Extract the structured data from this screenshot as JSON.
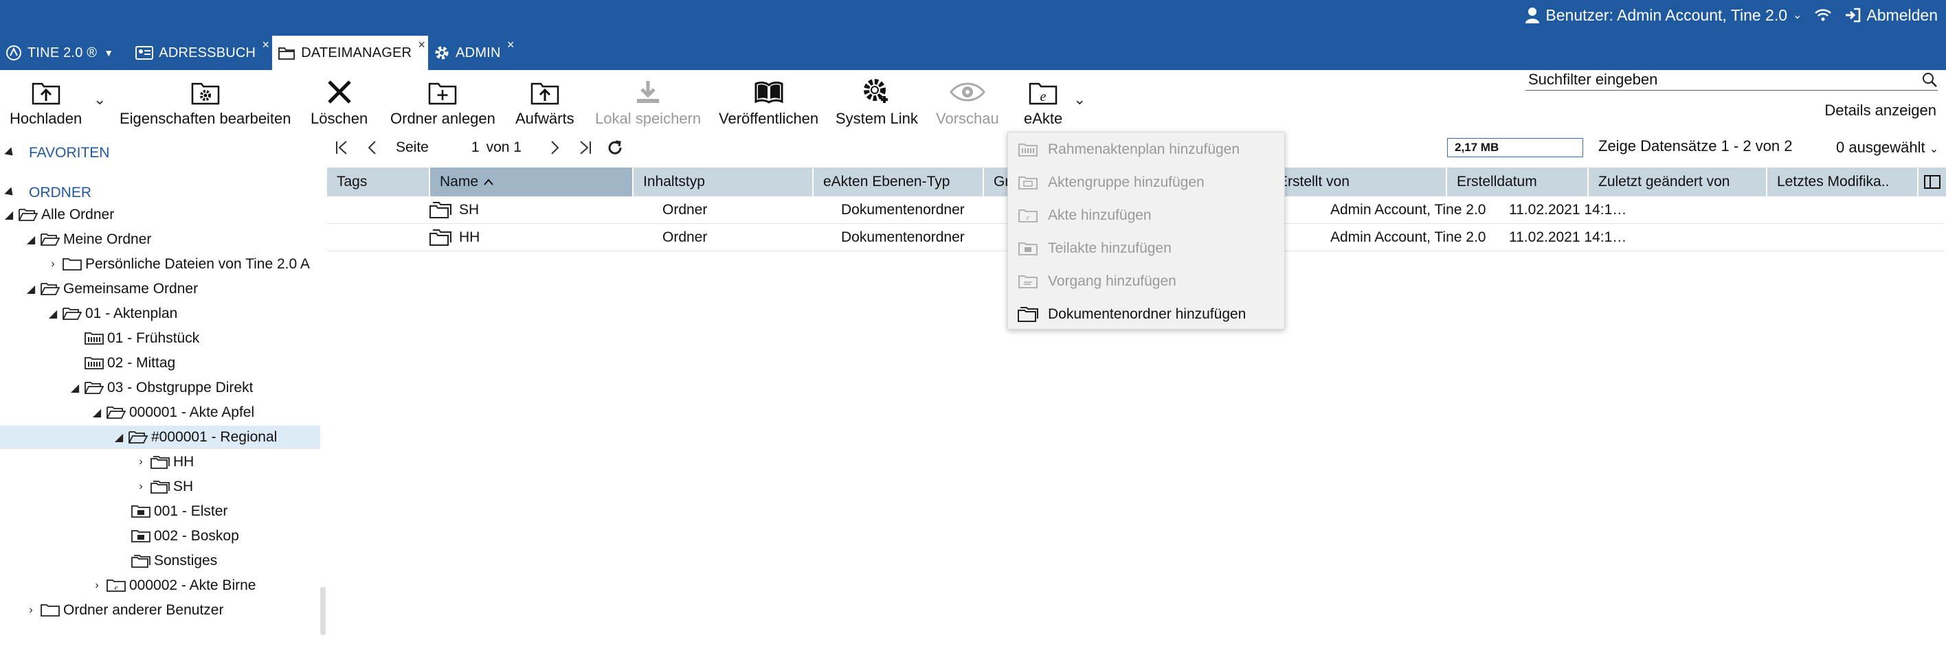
{
  "header": {
    "user_label": "Benutzer: Admin Account, Tine 2.0",
    "logout_label": "Abmelden"
  },
  "tabs": [
    {
      "label": "TINE 2.0 ®",
      "icon": "tine-logo-icon"
    },
    {
      "label": "ADRESSBUCH",
      "icon": "addressbook-icon"
    },
    {
      "label": "DATEIMANAGER",
      "icon": "filemanager-icon"
    },
    {
      "label": "ADMIN",
      "icon": "gear-icon"
    }
  ],
  "toolbar": {
    "upload": "Hochladen",
    "edit_properties": "Eigenschaften bearbeiten",
    "delete": "Löschen",
    "create_folder": "Ordner anlegen",
    "up": "Aufwärts",
    "save_locally": "Lokal speichern",
    "publish": "Veröffentlichen",
    "system_link": "System Link",
    "preview": "Vorschau",
    "eakte": "eAkte"
  },
  "search": {
    "placeholder": "Suchfilter eingeben"
  },
  "details_link": "Details anzeigen",
  "tree": {
    "favorites": "FAVORITEN",
    "folders": "ORDNER",
    "nodes": [
      {
        "label": "Alle Ordner"
      },
      {
        "label": "Meine Ordner"
      },
      {
        "label": "Persönliche Dateien von Tine 2.0 A"
      },
      {
        "label": "Gemeinsame Ordner"
      },
      {
        "label": "01 - Aktenplan"
      },
      {
        "label": "01 - Frühstück"
      },
      {
        "label": "02 - Mittag"
      },
      {
        "label": "03 - Obstgruppe Direkt"
      },
      {
        "label": "000001 - Akte Apfel"
      },
      {
        "label": "#000001 - Regional"
      },
      {
        "label": "HH"
      },
      {
        "label": "SH"
      },
      {
        "label": "001 - Elster"
      },
      {
        "label": "002 - Boskop"
      },
      {
        "label": "Sonstiges"
      },
      {
        "label": "000002 - Akte Birne"
      },
      {
        "label": "Ordner anderer Benutzer"
      }
    ]
  },
  "pager": {
    "page_label": "Seite",
    "page_value": "1",
    "of_label": "von 1",
    "size": "2,17 MB",
    "records": "Zeige Datensätze 1 - 2 von 2",
    "selected": "0 ausgewählt"
  },
  "columns": [
    "Tags",
    "Name",
    "Inhaltstyp",
    "eAkten Ebenen-Typ",
    "Gr",
    "Erstellt von",
    "Erstelldatum",
    "Zuletzt geändert von",
    "Letztes Modifika.."
  ],
  "rows": [
    {
      "name": "SH",
      "type": "Ordner",
      "level": "Dokumentenordner",
      "created_by": "Admin Account, Tine 2.0",
      "created": "11.02.2021 14:1…"
    },
    {
      "name": "HH",
      "type": "Ordner",
      "level": "Dokumentenordner",
      "created_by": "Admin Account, Tine 2.0",
      "created": "11.02.2021 14:1…"
    }
  ],
  "eakte_menu": [
    {
      "label": "Rahmenaktenplan hinzufügen",
      "enabled": false
    },
    {
      "label": "Aktengruppe hinzufügen",
      "enabled": false
    },
    {
      "label": "Akte hinzufügen",
      "enabled": false
    },
    {
      "label": "Teilakte hinzufügen",
      "enabled": false
    },
    {
      "label": "Vorgang hinzufügen",
      "enabled": false
    },
    {
      "label": "Dokumentenordner hinzufügen",
      "enabled": true
    }
  ]
}
